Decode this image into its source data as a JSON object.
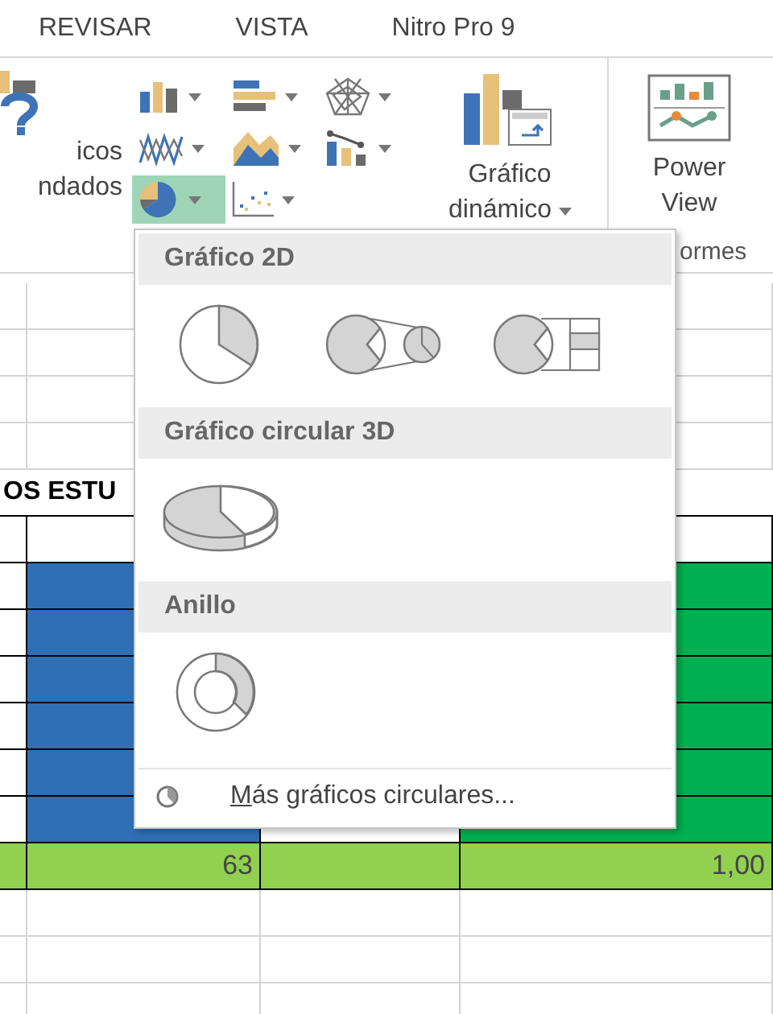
{
  "tabs": [
    {
      "label": "REVISAR",
      "selected": false
    },
    {
      "label": "VISTA",
      "selected": false
    },
    {
      "label": "Nitro Pro 9",
      "selected": false
    }
  ],
  "ribbon": {
    "recommended_label": [
      "icos",
      "ndados"
    ],
    "chart_buttons": [
      {
        "kind": "column",
        "selected": false
      },
      {
        "kind": "bar",
        "selected": false
      },
      {
        "kind": "radar",
        "selected": false
      },
      {
        "kind": "line",
        "selected": false
      },
      {
        "kind": "area",
        "selected": false
      },
      {
        "kind": "stat",
        "selected": false
      },
      {
        "kind": "pie",
        "selected": true
      },
      {
        "kind": "scatter",
        "selected": false
      }
    ],
    "pivot_chart_label": [
      "Gráfico",
      "dinámico"
    ],
    "power_view_label": [
      "Power",
      "View"
    ],
    "group_label": "ormes"
  },
  "menu": {
    "sections": [
      {
        "title": "Gráfico 2D",
        "items": [
          {
            "kind": "pie"
          },
          {
            "kind": "pie-of-pie"
          },
          {
            "kind": "bar-of-pie"
          }
        ]
      },
      {
        "title": "Gráfico circular 3D",
        "items": [
          {
            "kind": "pie-3d"
          }
        ]
      },
      {
        "title": "Anillo",
        "items": [
          {
            "kind": "doughnut"
          }
        ]
      }
    ],
    "more_link": "Más gráficos circulares..."
  },
  "sheet": {
    "rows": [
      {
        "kind": "blank-under-menu"
      },
      {
        "kind": "blank-under-menu"
      },
      {
        "kind": "blank-under-menu"
      },
      {
        "kind": "blank-under-menu"
      },
      {
        "kind": "title",
        "cells": [
          "OS ESTU"
        ]
      },
      {
        "kind": "header"
      },
      {
        "kind": "data"
      },
      {
        "kind": "data"
      },
      {
        "kind": "data"
      },
      {
        "kind": "data"
      },
      {
        "kind": "data"
      },
      {
        "kind": "data"
      },
      {
        "kind": "total",
        "cells": [
          "63",
          "1,00"
        ]
      },
      {
        "kind": "blank"
      },
      {
        "kind": "blank"
      },
      {
        "kind": "blank"
      }
    ]
  }
}
